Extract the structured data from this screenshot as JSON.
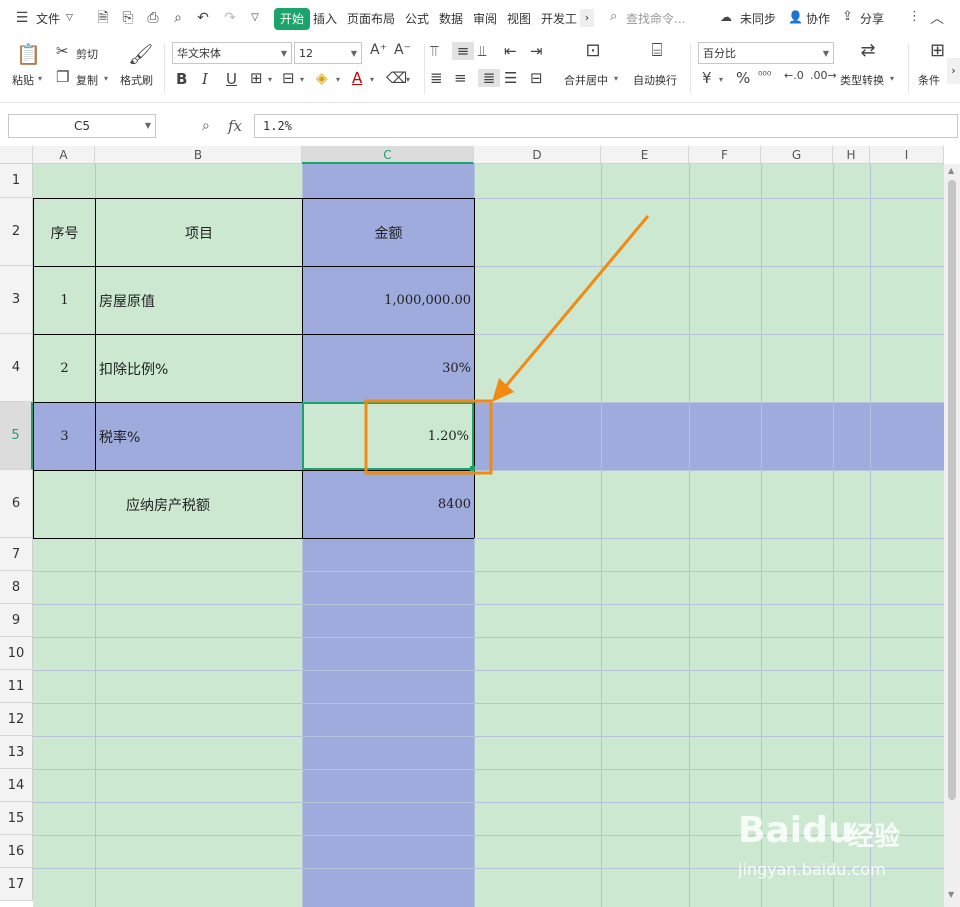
{
  "menu": {
    "file": "文件",
    "tabs": [
      "开始",
      "插入",
      "页面布局",
      "公式",
      "数据",
      "审阅",
      "视图",
      "开发工"
    ],
    "search_placeholder": "查找命令...",
    "sync": "未同步",
    "collab": "协作",
    "share": "分享"
  },
  "ribbon": {
    "paste": "粘贴",
    "cut": "剪切",
    "copy": "复制",
    "format_painter": "格式刷",
    "font_name": "华文宋体",
    "font_size": "12",
    "merge_center": "合并居中",
    "wrap": "自动换行",
    "number_format": "百分比",
    "type_convert": "类型转换",
    "conditional": "条件"
  },
  "formula_bar": {
    "cell_ref": "C5",
    "fx": "fx",
    "value": "1.2%"
  },
  "columns": [
    "A",
    "B",
    "C",
    "D",
    "E",
    "F",
    "G",
    "H",
    "I"
  ],
  "rows": [
    "1",
    "2",
    "3",
    "4",
    "5",
    "6",
    "7",
    "8",
    "9",
    "10",
    "11",
    "12",
    "13",
    "14",
    "15",
    "16",
    "17"
  ],
  "table": {
    "header": {
      "seq": "序号",
      "item": "项目",
      "amount": "金额"
    },
    "r3": {
      "seq": "1",
      "item": "房屋原值",
      "amount": "1,000,000.00"
    },
    "r4": {
      "seq": "2",
      "item": "扣除比例%",
      "amount": "30%"
    },
    "r5": {
      "seq": "3",
      "item": "税率%",
      "amount": "1.20%"
    },
    "r6": {
      "label": "应纳房产税额",
      "amount": "8400"
    }
  },
  "watermark": {
    "brand": "Baidu",
    "cn": "经验",
    "url": "jingyan.baidu.com"
  },
  "colors": {
    "accent": "#1aa36b",
    "sheet_green": "#cce8d1",
    "highlight_blue": "#9eabdc",
    "annotation": "#f08a12"
  }
}
